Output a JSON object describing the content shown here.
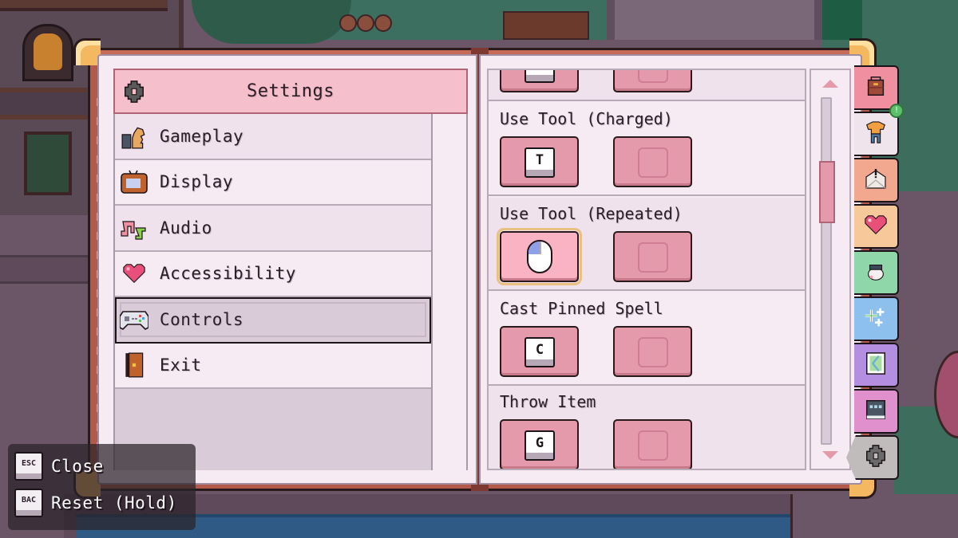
{
  "settings_menu": {
    "title": "Settings",
    "title_icon": "gear-icon",
    "items": [
      {
        "label": "Gameplay",
        "icon": "chess-knight-icon",
        "active": false
      },
      {
        "label": "Display",
        "icon": "tv-icon",
        "active": false
      },
      {
        "label": "Audio",
        "icon": "music-notes-icon",
        "active": false
      },
      {
        "label": "Accessibility",
        "icon": "heart-icon",
        "active": false
      },
      {
        "label": "Controls",
        "icon": "gamepad-icon",
        "active": true
      },
      {
        "label": "Exit",
        "icon": "door-icon",
        "active": false
      }
    ]
  },
  "bindings": {
    "rows": [
      {
        "label": "",
        "primary_key": "",
        "primary_type": "key",
        "secondary_key": ""
      },
      {
        "label": "Use Tool (Charged)",
        "primary_key": "T",
        "primary_type": "key",
        "secondary_key": ""
      },
      {
        "label": "Use Tool (Repeated)",
        "primary_key": "",
        "primary_type": "mouse-left",
        "secondary_key": ""
      },
      {
        "label": "Cast Pinned Spell",
        "primary_key": "C",
        "primary_type": "key",
        "secondary_key": ""
      },
      {
        "label": "Throw Item",
        "primary_key": "G",
        "primary_type": "key",
        "secondary_key": ""
      }
    ],
    "scroll_position": 0.22,
    "scroll_visible_fraction": 0.18
  },
  "side_tabs": [
    {
      "name": "inventory",
      "icon": "backpack-icon",
      "color": "#ef8fa0"
    },
    {
      "name": "equipment",
      "icon": "shirt-icon",
      "color": "#efe4ec",
      "badge": "!"
    },
    {
      "name": "quests",
      "icon": "envelope-alert-icon",
      "color": "#f2a88e"
    },
    {
      "name": "relationships",
      "icon": "heart-icon",
      "color": "#f7c89a"
    },
    {
      "name": "creatures",
      "icon": "cow-icon",
      "color": "#8fd6a8"
    },
    {
      "name": "spells",
      "icon": "sparkles-icon",
      "color": "#8ec0ee"
    },
    {
      "name": "map",
      "icon": "map-icon",
      "color": "#b48ee0"
    },
    {
      "name": "journal",
      "icon": "journal-icon",
      "color": "#e090cc"
    },
    {
      "name": "settings",
      "icon": "gear-icon",
      "color": "#c0bcbc",
      "active": true
    }
  ],
  "hints": [
    {
      "key": "ESC",
      "label": "Close"
    },
    {
      "key": "BAC",
      "label": "Reset (Hold)"
    }
  ]
}
